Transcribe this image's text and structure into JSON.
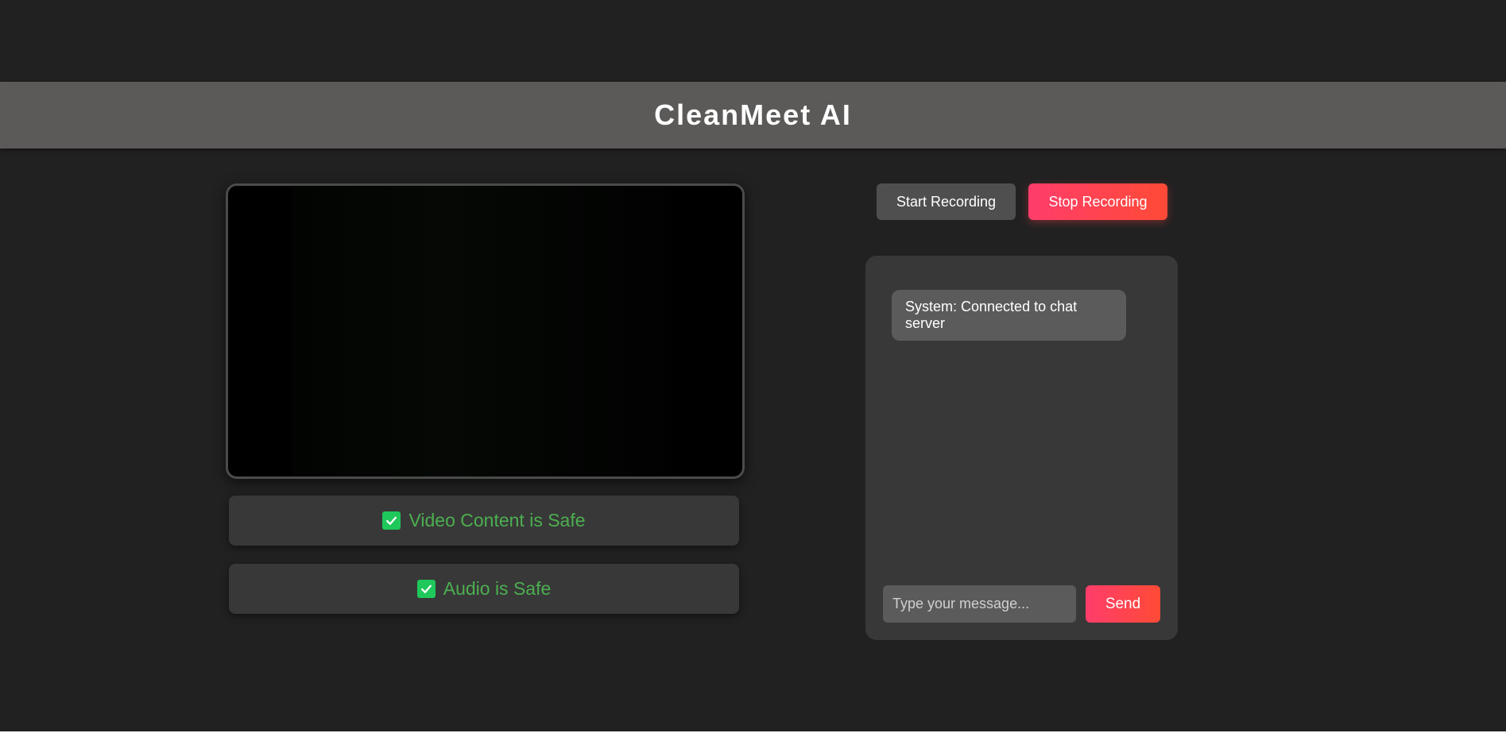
{
  "app": {
    "title": "CleanMeet AI"
  },
  "video": {
    "status": {
      "icon": "check-icon",
      "text": "Video Content is Safe"
    }
  },
  "audio": {
    "status": {
      "icon": "check-icon",
      "text": "Audio is Safe"
    }
  },
  "controls": {
    "start_label": "Start Recording",
    "stop_label": "Stop Recording"
  },
  "chat": {
    "messages": [
      {
        "text": "System: Connected to chat server"
      }
    ],
    "input_placeholder": "Type your message...",
    "send_label": "Send"
  },
  "colors": {
    "background": "#222122",
    "header": "#5c5a59",
    "panel": "#383838",
    "accent_gradient_start": "#ff3d6b",
    "accent_gradient_end": "#ff4a36",
    "safe_text": "#4caf50",
    "check": "#1fc85a"
  }
}
